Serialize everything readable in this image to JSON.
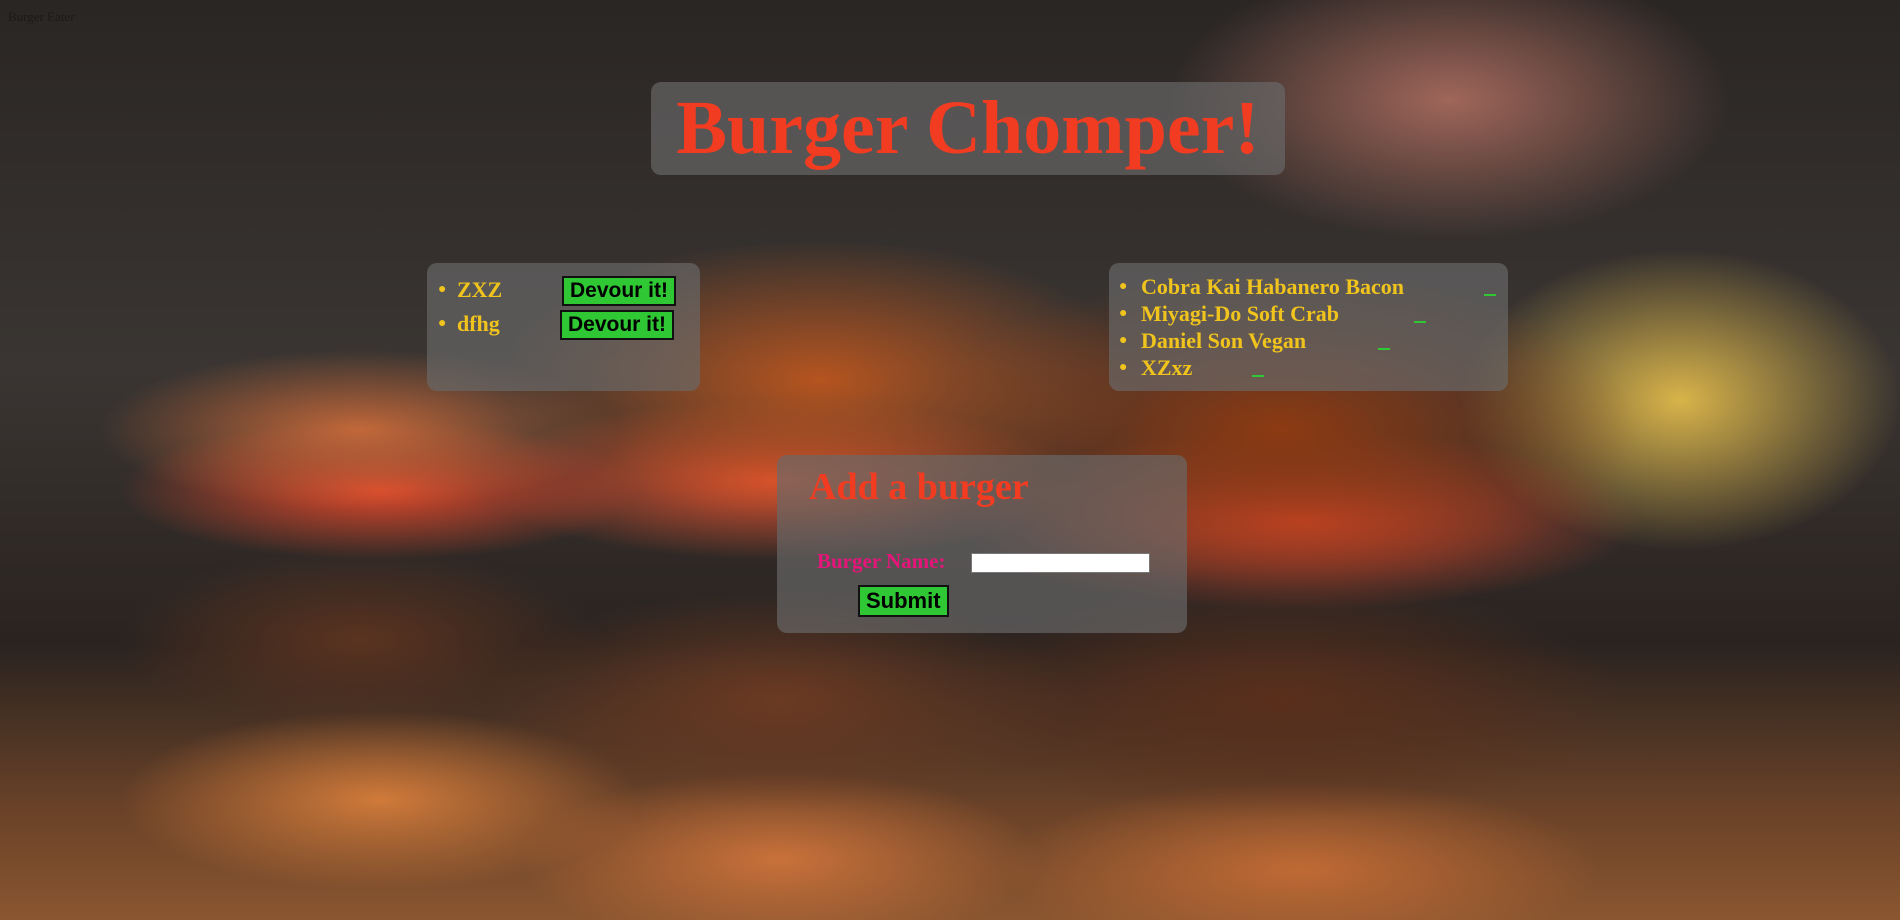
{
  "page": {
    "tab_label": "Burger Eater",
    "title": "Burger Chomper!",
    "background": "burger-photo"
  },
  "uneaten": {
    "items": [
      {
        "name": "ZXZ",
        "button_label": "Devour it!"
      },
      {
        "name": "dfhg",
        "button_label": "Devour it!"
      }
    ]
  },
  "eaten": {
    "items": [
      {
        "name": "Cobra Kai Habanero Bacon"
      },
      {
        "name": "Miyagi-Do Soft Crab"
      },
      {
        "name": "Daniel Son Vegan"
      },
      {
        "name": "XZxz"
      }
    ]
  },
  "add_form": {
    "heading": "Add a burger",
    "label": "Burger Name:",
    "input_value": "",
    "submit_label": "Submit"
  },
  "colors": {
    "title": "#f23c22",
    "list_text": "#f0c41c",
    "form_label": "#e5157a",
    "button": "#2fc734",
    "panel": "rgba(105,105,105,0.68)"
  }
}
